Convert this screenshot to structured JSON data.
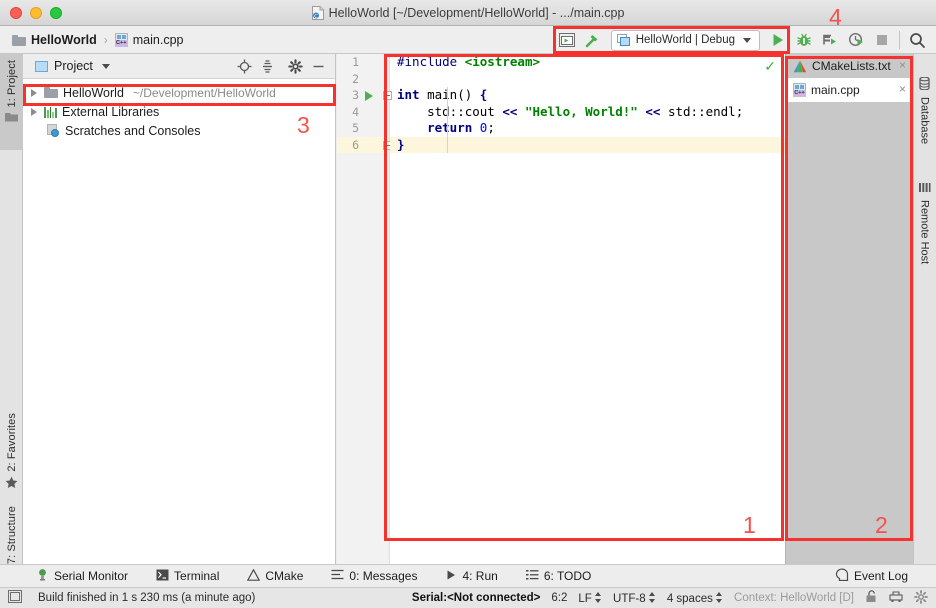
{
  "window": {
    "title": "HelloWorld [~/Development/HelloWorld] - .../main.cpp",
    "title_icon": "cpp-file-icon",
    "traffic_lights": [
      "close-button",
      "minimize-button",
      "maximize-button"
    ]
  },
  "breadcrumb": {
    "project": "HelloWorld",
    "separator": "›",
    "file": "main.cpp"
  },
  "toolbar": {
    "run_config_button_label": "HelloWorld | Debug",
    "icons": [
      "toolbar-window-icon",
      "build-hammer-icon",
      "run-icon",
      "debug-icon",
      "run-with-coverage-icon",
      "profile-icon",
      "stop-icon",
      "search-everywhere-icon"
    ]
  },
  "left_tool_strip": {
    "tabs": [
      {
        "label": "1: Project",
        "shortcut": "1",
        "icon": "project-folder-icon",
        "active": true
      },
      {
        "label": "2: Favorites",
        "shortcut": "2",
        "icon": "star-icon",
        "active": false
      },
      {
        "label": "7: Structure",
        "shortcut": "7",
        "icon": "structure-icon",
        "active": false
      }
    ]
  },
  "right_tool_strip": {
    "tabs": [
      {
        "label": "Database",
        "icon": "database-icon"
      },
      {
        "label": "Remote Host",
        "icon": "remote-host-icon"
      }
    ]
  },
  "project_panel": {
    "header_title": "Project",
    "header_actions": [
      "locate-target-icon",
      "collapse-all-icon",
      "settings-gear-icon",
      "hide-panel-icon"
    ],
    "tree": [
      {
        "label": "HelloWorld",
        "path": "~/Development/HelloWorld",
        "icon": "folder-icon",
        "expandable": true,
        "highlighted": true
      },
      {
        "label": "External Libraries",
        "path": "",
        "icon": "libraries-icon",
        "expandable": true,
        "highlighted": false
      },
      {
        "label": "Scratches and Consoles",
        "path": "",
        "icon": "scratches-icon",
        "expandable": false,
        "highlighted": false
      }
    ]
  },
  "editor": {
    "filename": "main.cpp",
    "inspection_status_icon": "inspection-ok-check",
    "highlighted_line": 6,
    "run_gutter_line": 3,
    "lines": [
      {
        "n": 1,
        "tokens": [
          {
            "t": "#include ",
            "c": "pre"
          },
          {
            "t": "<iostream>",
            "c": "inc"
          }
        ]
      },
      {
        "n": 2,
        "tokens": []
      },
      {
        "n": 3,
        "tokens": [
          {
            "t": "int",
            "c": "kw"
          },
          {
            "t": " main() ",
            "c": "plain"
          },
          {
            "t": "{",
            "c": "kw"
          }
        ]
      },
      {
        "n": 4,
        "tokens": [
          {
            "t": "    std::cout ",
            "c": "plain"
          },
          {
            "t": "<<",
            "c": "kw"
          },
          {
            "t": " ",
            "c": "plain"
          },
          {
            "t": "\"Hello, World!\"",
            "c": "str"
          },
          {
            "t": " ",
            "c": "plain"
          },
          {
            "t": "<<",
            "c": "kw"
          },
          {
            "t": " std::endl;",
            "c": "plain"
          }
        ]
      },
      {
        "n": 5,
        "tokens": [
          {
            "t": "    ",
            "c": "plain"
          },
          {
            "t": "return",
            "c": "kw"
          },
          {
            "t": " ",
            "c": "plain"
          },
          {
            "t": "0",
            "c": "num0"
          },
          {
            "t": ";",
            "c": "plain"
          }
        ]
      },
      {
        "n": 6,
        "tokens": [
          {
            "t": "}",
            "c": "kw"
          }
        ]
      }
    ]
  },
  "right_file_panel": {
    "tabs": [
      {
        "label": "CMakeLists.txt",
        "icon": "cmake-icon",
        "selected": false,
        "close": "×"
      },
      {
        "label": "main.cpp",
        "icon": "cpp-file-icon",
        "selected": true,
        "close": "×"
      }
    ]
  },
  "bottom_bar": {
    "items": [
      {
        "label": "Serial Monitor",
        "shortcut": "",
        "icon": "serial-monitor-icon"
      },
      {
        "label": "Terminal",
        "shortcut": "",
        "icon": "terminal-icon"
      },
      {
        "label": "CMake",
        "shortcut": "",
        "icon": "cmake-icon"
      },
      {
        "label": "0: Messages",
        "shortcut": "0",
        "icon": "messages-icon"
      },
      {
        "label": "4: Run",
        "shortcut": "4",
        "icon": "run-icon"
      },
      {
        "label": "6: TODO",
        "shortcut": "6",
        "icon": "todo-icon"
      }
    ],
    "event_log": {
      "label": "Event Log",
      "icon": "event-log-icon"
    }
  },
  "status_bar": {
    "build_message": "Build finished in 1 s 230 ms (a minute ago)",
    "serial_status": "Serial:<Not connected>",
    "caret_position": "6:2",
    "line_separator": "LF",
    "encoding": "UTF-8",
    "indent": "4 spaces",
    "context": "Context: HelloWorld [D]",
    "icons": [
      "toggle-tool-window-icon",
      "lock-icon",
      "git-branch-icon",
      "ide-settings-icon"
    ]
  },
  "annotations": [
    {
      "id": "1",
      "label": "1",
      "target": "editor-area"
    },
    {
      "id": "2",
      "label": "2",
      "target": "right-file-panel"
    },
    {
      "id": "3",
      "label": "3",
      "target": "project-tree-root-row"
    },
    {
      "id": "4",
      "label": "4",
      "target": "run-configuration-toolbar"
    }
  ],
  "colors": {
    "annotation_red": "#f5332e",
    "accent_green": "#4caf50",
    "string_green": "#008000",
    "keyword_blue": "#000080",
    "highlight_yellow": "#fdf6dd"
  }
}
